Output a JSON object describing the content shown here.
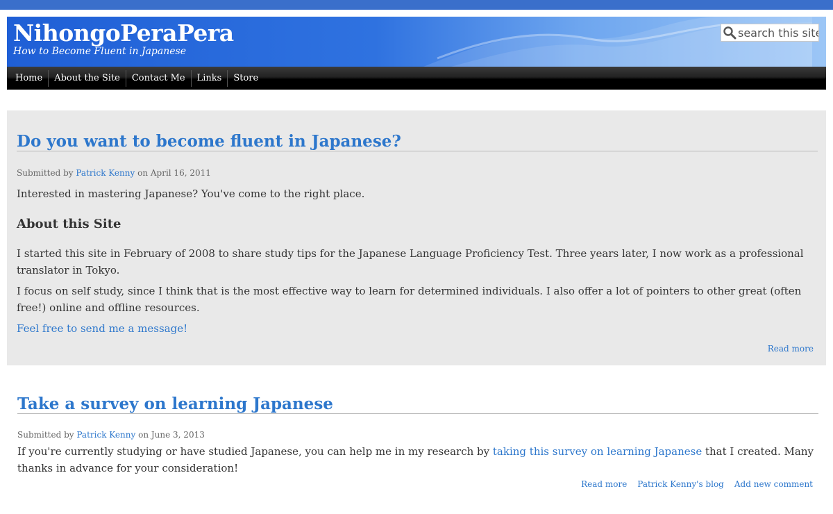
{
  "site": {
    "name": "NihongoPeraPera",
    "slogan": "How to Become Fluent in Japanese",
    "search_placeholder": "search this site"
  },
  "nav": {
    "items": [
      {
        "label": "Home"
      },
      {
        "label": "About the Site"
      },
      {
        "label": "Contact Me"
      },
      {
        "label": "Links"
      },
      {
        "label": "Store"
      }
    ]
  },
  "posts": [
    {
      "title": "Do you want to become fluent in Japanese?",
      "submitted_prefix": "Submitted by",
      "author": "Patrick Kenny",
      "date_text": "on April 16, 2011",
      "intro": "Interested in mastering Japanese? You've come to the right place.",
      "subheading": "About this Site",
      "para1": "I started this site in February of 2008 to share study tips for the Japanese Language Proficiency Test. Three years later, I now work as a professional translator in Tokyo.",
      "para2": "I focus on self study, since I think that is the most effective way to learn for determined individuals. I also offer a lot of pointers to other great (often free!) online and offline resources.",
      "message_link": "Feel free to send me a message!",
      "read_more": "Read more"
    },
    {
      "title": "Take a survey on learning Japanese",
      "submitted_prefix": "Submitted by",
      "author": "Patrick Kenny",
      "date_text": "on June 3, 2013",
      "text_before": "If you're currently studying or have studied Japanese, you can help me in my research by ",
      "survey_link": "taking this survey on learning Japanese",
      "text_after": " that I created. Many thanks in advance for your consideration!",
      "read_more": "Read more",
      "blog_link": "Patrick Kenny's blog",
      "comment_link": "Add new comment"
    }
  ],
  "colors": {
    "accent_link": "#2d77cc",
    "header_blue": "#1f5fd6",
    "topbar": "#3a6fcb",
    "post_bg": "#e9e9e9"
  },
  "icons": {
    "search": "magnifier-icon"
  }
}
